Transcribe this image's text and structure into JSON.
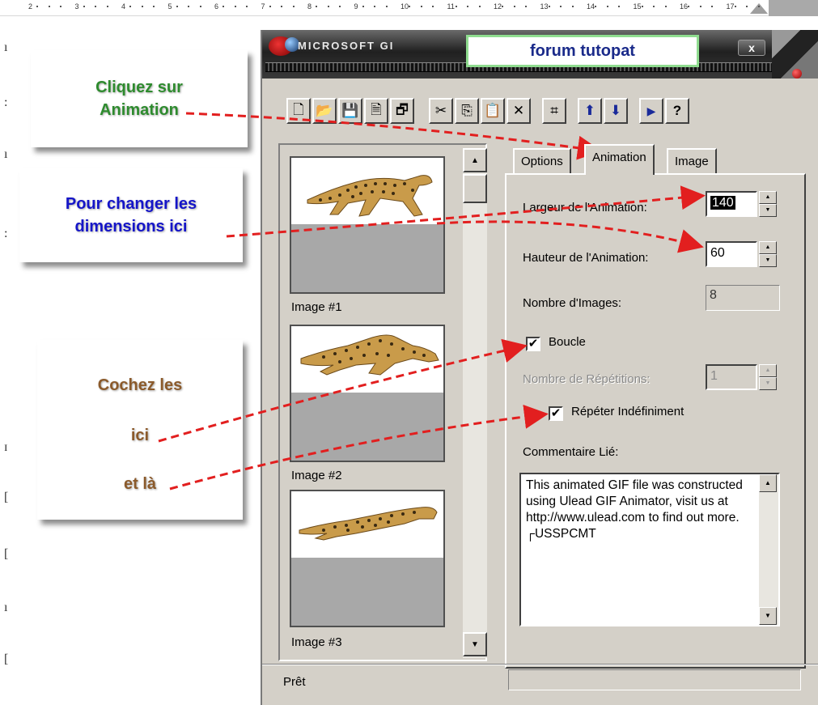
{
  "ruler": {
    "numbers": [
      "2",
      "3",
      "4",
      "5",
      "6",
      "7",
      "8",
      "9",
      "10",
      "11",
      "12",
      "13",
      "14",
      "15",
      "16",
      "17"
    ]
  },
  "callouts": {
    "animation": {
      "text": "Cliquez sur Animation",
      "color": "#2e8b2e"
    },
    "dimensions": {
      "text": "Pour changer les dimensions ici",
      "color": "#1515c8"
    },
    "cochez": {
      "line1": "Cochez les",
      "line2": "ici",
      "line3": "et là",
      "color": "#8b5a2b"
    }
  },
  "window": {
    "app_title": "MICROSOFT GI",
    "banner": "forum tutopat",
    "close": "x"
  },
  "toolbar": {
    "buttons": [
      {
        "name": "new-icon",
        "glyph": "🗋"
      },
      {
        "name": "open-icon",
        "glyph": "📂"
      },
      {
        "name": "save-icon",
        "glyph": "💾"
      },
      {
        "name": "insert-icon",
        "glyph": "🗎"
      },
      {
        "name": "save-all-icon",
        "glyph": "🗗"
      },
      {
        "name": "cut-icon",
        "glyph": "✂"
      },
      {
        "name": "copy-icon",
        "glyph": "⎘"
      },
      {
        "name": "paste-icon",
        "glyph": "📋"
      },
      {
        "name": "delete-icon",
        "glyph": "✕"
      },
      {
        "name": "select-all-icon",
        "glyph": "⌗"
      },
      {
        "name": "move-up-icon",
        "glyph": "⬆"
      },
      {
        "name": "move-down-icon",
        "glyph": "⬇"
      },
      {
        "name": "preview-icon",
        "glyph": "▶"
      },
      {
        "name": "help-icon",
        "glyph": "?"
      }
    ]
  },
  "frames": [
    {
      "label": "Image #1"
    },
    {
      "label": "Image #2"
    },
    {
      "label": "Image #3"
    }
  ],
  "tabs": [
    {
      "label": "Options"
    },
    {
      "label": "Animation"
    },
    {
      "label": "Image"
    }
  ],
  "animation": {
    "width_label": "Largeur de l'Animation:",
    "width_value": "140",
    "height_label": "Hauteur de l'Animation:",
    "height_value": "60",
    "frames_label": "Nombre d'Images:",
    "frames_value": "8",
    "loop_label": "Boucle",
    "loop_checked": "✔",
    "repetitions_label": "Nombre de Répétitions:",
    "repetitions_value": "1",
    "repeat_forever_label": "Répéter Indéfiniment",
    "repeat_forever_checked": "✔",
    "comment_label": "Commentaire Lié:",
    "comment_text": "This animated GIF file was constructed using Ulead GIF Animator, visit us at http://www.ulead.com to find out more. ┌USSPCMT"
  },
  "status": {
    "text": "Prêt"
  }
}
